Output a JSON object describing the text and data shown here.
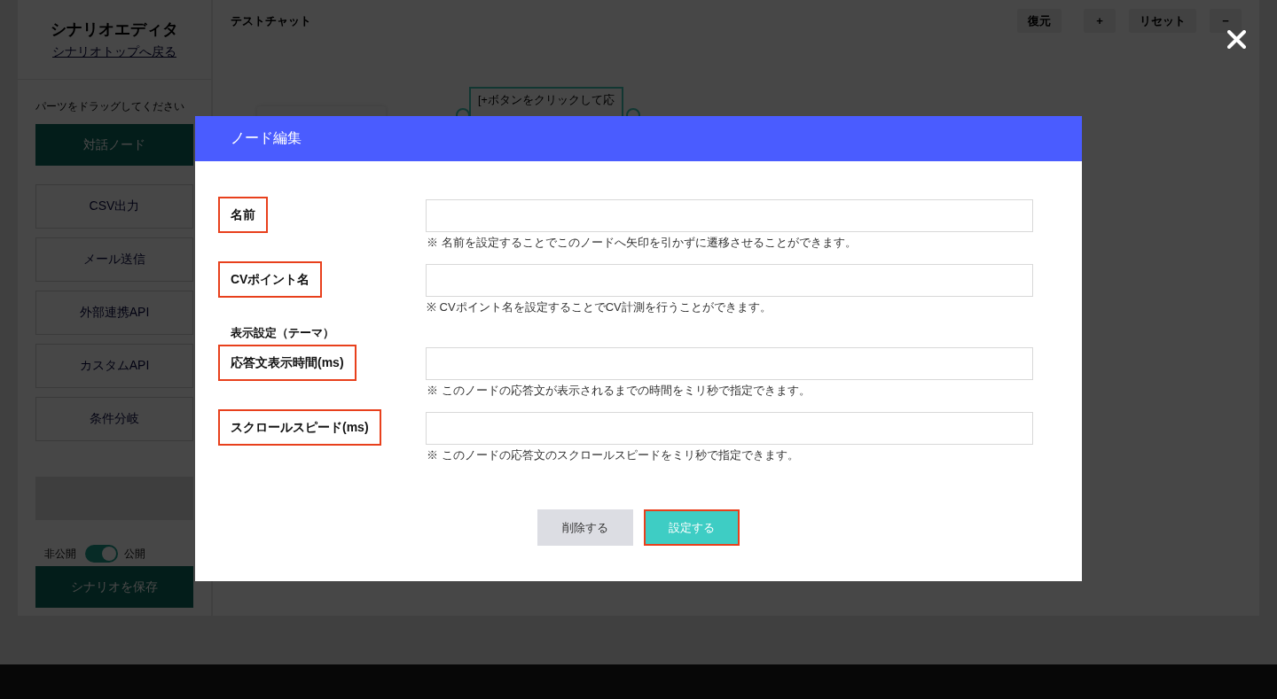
{
  "sidebar": {
    "title": "シナリオエディタ",
    "back_link": "シナリオトップへ戻る",
    "instruction": "パーツをドラッグしてください",
    "parts": [
      {
        "label": "対話ノード",
        "kind": "primary"
      },
      {
        "label": "CSV出力",
        "kind": "outline"
      },
      {
        "label": "メール送信",
        "kind": "outline"
      },
      {
        "label": "外部連携API",
        "kind": "outline"
      },
      {
        "label": "カスタムAPI",
        "kind": "outline"
      },
      {
        "label": "条件分岐",
        "kind": "outline"
      }
    ],
    "visibility": {
      "off_label": "非公開",
      "on_label": "公開",
      "on": true
    },
    "save_button": "シナリオを保存"
  },
  "canvas": {
    "title": "テストチャット",
    "toolbar": [
      "復元",
      "+",
      "リセット",
      "−"
    ],
    "node": {
      "text": "[+ボタンをクリックして応"
    }
  },
  "modal": {
    "title": "ノード編集",
    "fields": [
      {
        "kind": "input",
        "label": "名前",
        "highlighted": true,
        "hint": "※ 名前を設定することでこのノードへ矢印を引かずに遷移させることができます。"
      },
      {
        "kind": "input",
        "label": "CVポイント名",
        "highlighted": true,
        "hint": "※ CVポイント名を設定することでCV計測を行うことができます。"
      },
      {
        "kind": "section",
        "label": "表示設定（テーマ）"
      },
      {
        "kind": "input",
        "label": "応答文表示時間(ms)",
        "highlighted": true,
        "hint": "※ このノードの応答文が表示されるまでの時間をミリ秒で指定できます。"
      },
      {
        "kind": "input",
        "label": "スクロールスピード(ms)",
        "highlighted": true,
        "hint": "※ このノードの応答文のスクロールスピードをミリ秒で指定できます。"
      }
    ],
    "buttons": [
      {
        "label": "削除する",
        "kind": "secondary",
        "highlighted": false
      },
      {
        "label": "設定する",
        "kind": "primary",
        "highlighted": true
      }
    ]
  }
}
